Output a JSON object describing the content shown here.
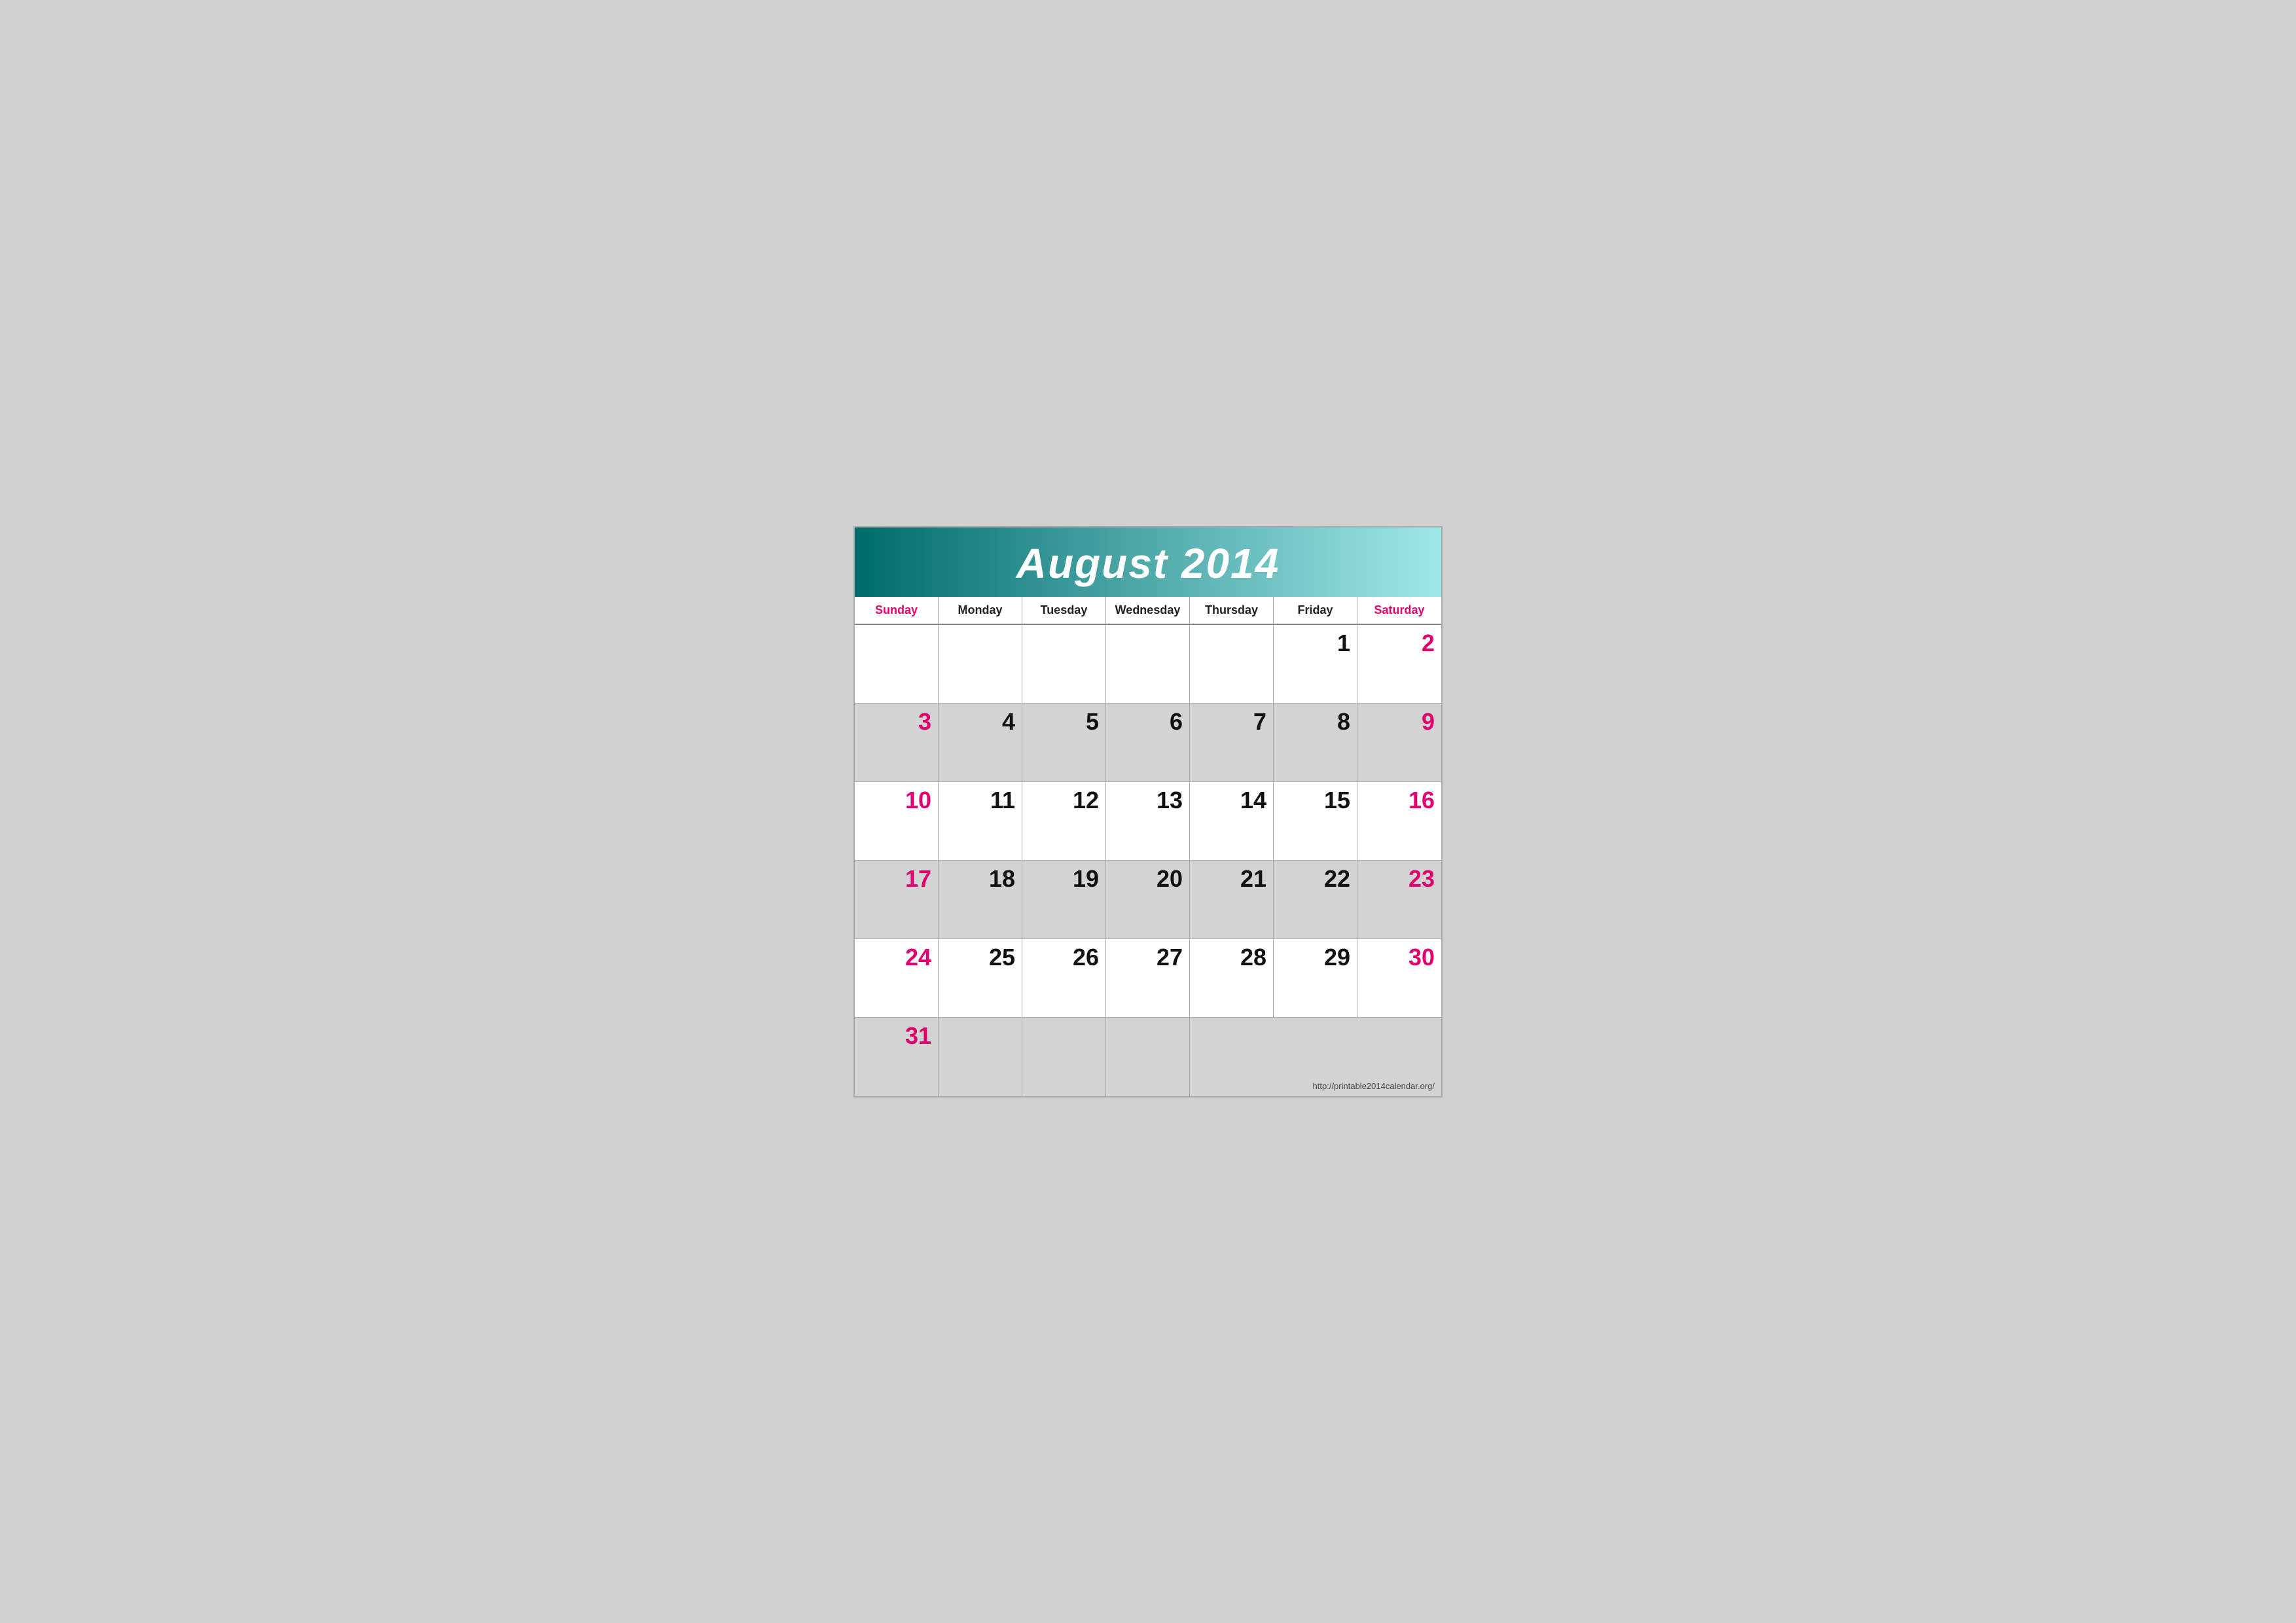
{
  "header": {
    "title": "August 2014",
    "gradient_start": "#006b6b",
    "gradient_end": "#a0e8e8"
  },
  "days_of_week": [
    {
      "label": "Sunday",
      "type": "weekend"
    },
    {
      "label": "Monday",
      "type": "weekday"
    },
    {
      "label": "Tuesday",
      "type": "weekday"
    },
    {
      "label": "Wednesday",
      "type": "weekday"
    },
    {
      "label": "Thursday",
      "type": "weekday"
    },
    {
      "label": "Friday",
      "type": "weekday"
    },
    {
      "label": "Saturday",
      "type": "weekend"
    }
  ],
  "weeks": [
    [
      {
        "day": "",
        "type": "empty",
        "color": "white"
      },
      {
        "day": "",
        "type": "empty",
        "color": "white"
      },
      {
        "day": "",
        "type": "empty",
        "color": "white"
      },
      {
        "day": "",
        "type": "empty",
        "color": "white"
      },
      {
        "day": "",
        "type": "empty",
        "color": "white"
      },
      {
        "day": "1",
        "type": "weekday",
        "color": "white"
      },
      {
        "day": "2",
        "type": "weekend",
        "color": "white"
      }
    ],
    [
      {
        "day": "3",
        "type": "weekend",
        "color": "gray"
      },
      {
        "day": "4",
        "type": "weekday",
        "color": "gray"
      },
      {
        "day": "5",
        "type": "weekday",
        "color": "gray"
      },
      {
        "day": "6",
        "type": "weekday",
        "color": "gray"
      },
      {
        "day": "7",
        "type": "weekday",
        "color": "gray"
      },
      {
        "day": "8",
        "type": "weekday",
        "color": "gray"
      },
      {
        "day": "9",
        "type": "weekend",
        "color": "gray"
      }
    ],
    [
      {
        "day": "10",
        "type": "weekend",
        "color": "white"
      },
      {
        "day": "11",
        "type": "weekday",
        "color": "white"
      },
      {
        "day": "12",
        "type": "weekday",
        "color": "white"
      },
      {
        "day": "13",
        "type": "weekday",
        "color": "white"
      },
      {
        "day": "14",
        "type": "weekday",
        "color": "white"
      },
      {
        "day": "15",
        "type": "weekday",
        "color": "white"
      },
      {
        "day": "16",
        "type": "weekend",
        "color": "white"
      }
    ],
    [
      {
        "day": "17",
        "type": "weekend",
        "color": "gray"
      },
      {
        "day": "18",
        "type": "weekday",
        "color": "gray"
      },
      {
        "day": "19",
        "type": "weekday",
        "color": "gray"
      },
      {
        "day": "20",
        "type": "weekday",
        "color": "gray"
      },
      {
        "day": "21",
        "type": "weekday",
        "color": "gray"
      },
      {
        "day": "22",
        "type": "weekday",
        "color": "gray"
      },
      {
        "day": "23",
        "type": "weekend",
        "color": "gray"
      }
    ],
    [
      {
        "day": "24",
        "type": "weekend",
        "color": "white"
      },
      {
        "day": "25",
        "type": "weekday",
        "color": "white"
      },
      {
        "day": "26",
        "type": "weekday",
        "color": "white"
      },
      {
        "day": "27",
        "type": "weekday",
        "color": "white"
      },
      {
        "day": "28",
        "type": "weekday",
        "color": "white"
      },
      {
        "day": "29",
        "type": "weekday",
        "color": "white"
      },
      {
        "day": "30",
        "type": "weekend",
        "color": "white"
      }
    ],
    [
      {
        "day": "31",
        "type": "weekend",
        "color": "gray"
      },
      {
        "day": "",
        "type": "empty",
        "color": "gray"
      },
      {
        "day": "",
        "type": "empty",
        "color": "gray"
      },
      {
        "day": "",
        "type": "empty",
        "color": "gray"
      },
      {
        "day": "",
        "type": "empty",
        "color": "gray"
      },
      {
        "day": "",
        "type": "empty",
        "color": "gray"
      },
      {
        "day": "",
        "type": "empty",
        "color": "gray"
      }
    ]
  ],
  "footer": {
    "url": "http://printable2014calendar.org/"
  },
  "colors": {
    "weekend": "#e0006e",
    "weekday": "#111111",
    "accent_start": "#006b6b",
    "accent_end": "#a0e8e8"
  }
}
